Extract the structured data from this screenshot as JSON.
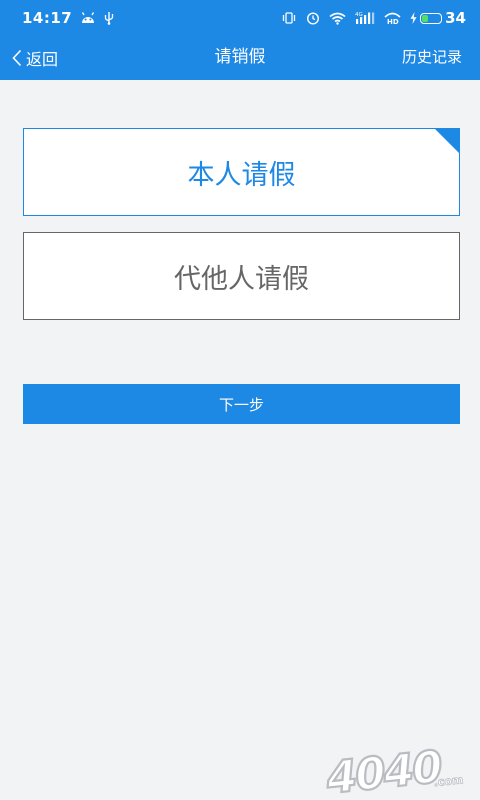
{
  "status_bar": {
    "time": "14:17",
    "battery_level": "34",
    "battery_fraction": 0.34,
    "network_label": "4G",
    "hd_label": "HD",
    "icons": [
      "android-icon",
      "usb-icon",
      "vibrate-icon",
      "alarm-icon",
      "wifi-icon",
      "signal-icon",
      "hd-call-icon",
      "charging-icon",
      "battery-icon"
    ]
  },
  "header": {
    "back_label": "返回",
    "title": "请销假",
    "history_label": "历史记录"
  },
  "options": {
    "self_label": "本人请假",
    "other_label": "代他人请假",
    "selected": "self"
  },
  "next_button_label": "下一步",
  "watermark": {
    "text": "4040",
    "suffix": ".com"
  },
  "colors": {
    "primary": "#1e88e5",
    "background": "#f2f3f5",
    "unselected_text": "#666666",
    "battery_fill": "#4ee06a"
  }
}
